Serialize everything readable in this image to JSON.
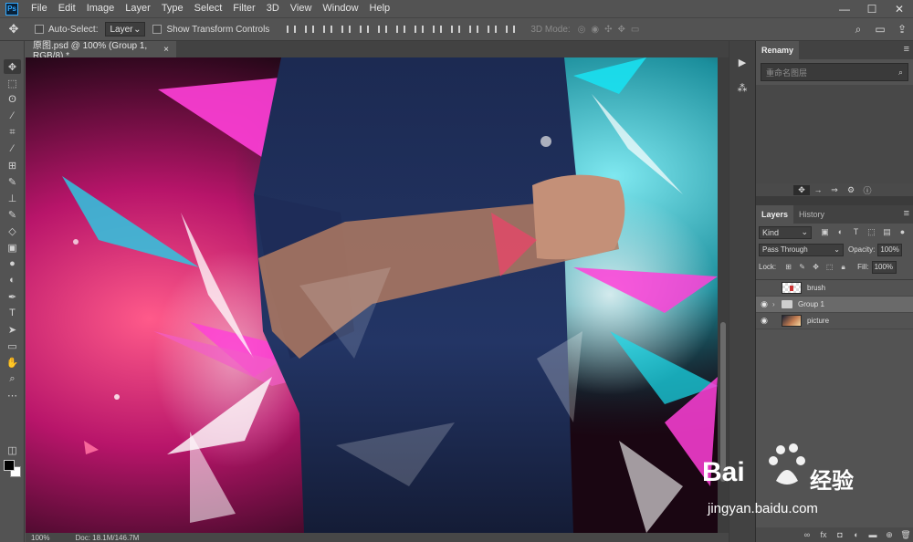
{
  "app": {
    "logo": "Ps"
  },
  "menu": [
    "File",
    "Edit",
    "Image",
    "Layer",
    "Type",
    "Select",
    "Filter",
    "3D",
    "View",
    "Window",
    "Help"
  ],
  "window_controls": {
    "minimize": "—",
    "maximize": "☐",
    "close": "✕"
  },
  "options_bar": {
    "auto_select_label": "Auto-Select:",
    "auto_select_target": "Layer",
    "show_transform_label": "Show Transform Controls",
    "mode_3d_label": "3D Mode:"
  },
  "document": {
    "tab_title": "原图.psd @ 100% (Group 1, RGB/8) *",
    "close_glyph": "×",
    "zoom": "100%",
    "doc_size": "Doc: 18.1M/146.7M"
  },
  "rename_panel": {
    "tab_label": "Renamy",
    "input_placeholder": "重命名图层"
  },
  "layers_panel": {
    "tabs": [
      "Layers",
      "History"
    ],
    "filter_kind": "Kind",
    "blend_mode": "Pass Through",
    "opacity_label": "Opacity:",
    "opacity_value": "100%",
    "lock_label": "Lock:",
    "fill_label": "Fill:",
    "fill_value": "100%",
    "layers": [
      {
        "name": "brush",
        "visible": false,
        "type": "pixel",
        "selected": false
      },
      {
        "name": "Group 1",
        "visible": true,
        "type": "group",
        "selected": true
      },
      {
        "name": "picture",
        "visible": true,
        "type": "image",
        "selected": false
      }
    ]
  },
  "watermark": {
    "brand_text": "Bai",
    "brand_suffix": "经验",
    "url": "jingyan.baidu.com"
  },
  "colors": {
    "ui_bg": "#535353",
    "panel_dark": "#424242",
    "accent_magenta": "#ff2fd6",
    "accent_cyan": "#19d6e8"
  },
  "icons": {
    "tools": [
      "move-icon",
      "marquee-icon",
      "lasso-icon",
      "magic-wand-icon",
      "crop-icon",
      "eyedropper-icon",
      "healing-icon",
      "brush-icon",
      "stamp-icon",
      "history-brush-icon",
      "eraser-icon",
      "gradient-icon",
      "blur-icon",
      "dodge-icon",
      "pen-icon",
      "type-icon",
      "path-select-icon",
      "rectangle-icon",
      "hand-icon",
      "zoom-icon",
      "more-icon"
    ]
  }
}
